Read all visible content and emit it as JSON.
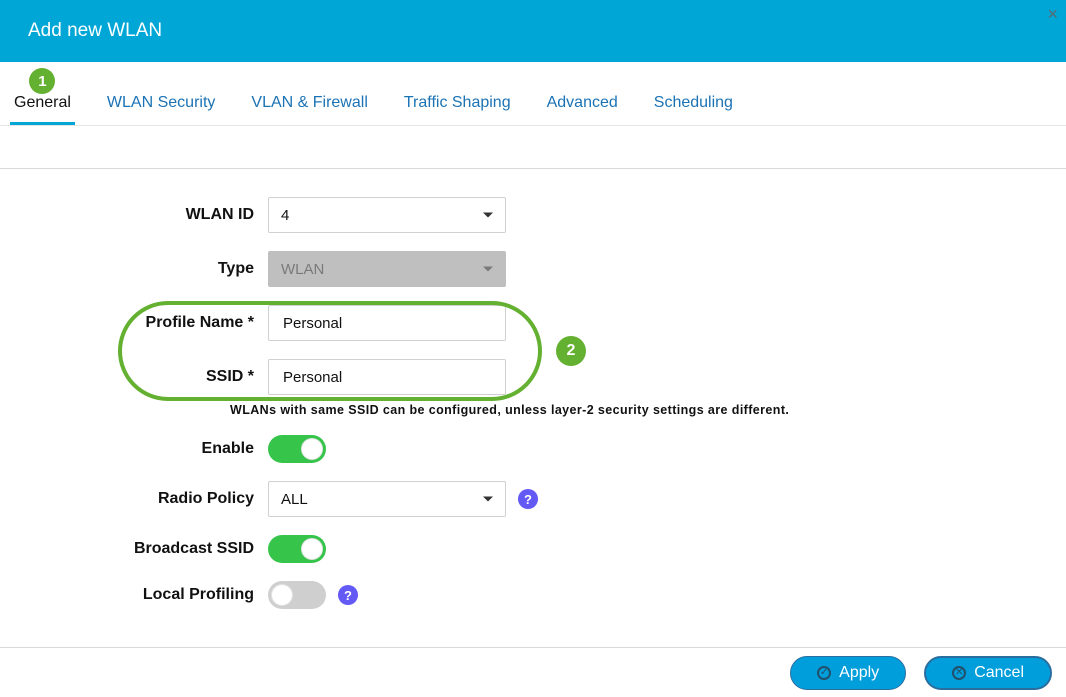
{
  "header": {
    "title": "Add new WLAN",
    "close_label": "×"
  },
  "tabs": {
    "items": [
      {
        "label": "General",
        "active": true
      },
      {
        "label": "WLAN Security",
        "active": false
      },
      {
        "label": "VLAN & Firewall",
        "active": false
      },
      {
        "label": "Traffic Shaping",
        "active": false
      },
      {
        "label": "Advanced",
        "active": false
      },
      {
        "label": "Scheduling",
        "active": false
      }
    ]
  },
  "callouts": {
    "step1": "1",
    "step2": "2"
  },
  "form": {
    "wlan_id": {
      "label": "WLAN ID",
      "value": "4"
    },
    "type": {
      "label": "Type",
      "value": "WLAN",
      "disabled": true
    },
    "profile_name": {
      "label": "Profile Name *",
      "value": "Personal"
    },
    "ssid": {
      "label": "SSID *",
      "value": "Personal",
      "hint": "WLANs with same SSID can be configured, unless layer-2 security settings are different."
    },
    "enable": {
      "label": "Enable",
      "on": true
    },
    "radio_policy": {
      "label": "Radio Policy",
      "value": "ALL",
      "help": "?"
    },
    "broadcast_ssid": {
      "label": "Broadcast SSID",
      "on": true
    },
    "local_profiling": {
      "label": "Local Profiling",
      "on": false,
      "help": "?"
    }
  },
  "footer": {
    "apply": "Apply",
    "cancel": "Cancel"
  }
}
